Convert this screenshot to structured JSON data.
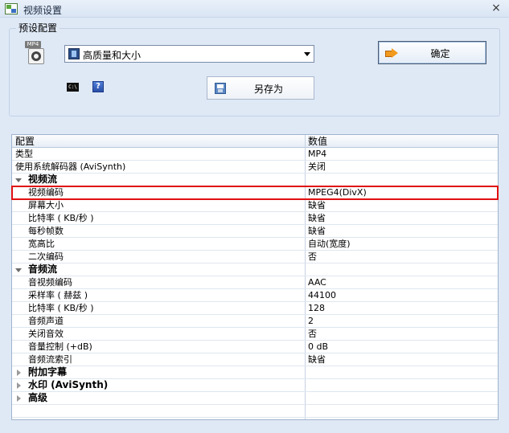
{
  "window": {
    "title": "视频设置",
    "close_glyph": "×"
  },
  "preset": {
    "group_label": "预设配置",
    "icon_tag": "MP4",
    "selected": "高质量和大小",
    "ok_label": "确定",
    "save_as_label": "另存为",
    "cmd_icon_text": "C:\\",
    "help_icon_text": "?"
  },
  "grid": {
    "columns": [
      "配置",
      "数值"
    ],
    "rows": [
      {
        "type": "item",
        "key": "类型",
        "value": "MP4"
      },
      {
        "type": "item",
        "key": "使用系统解码器 (AviSynth)",
        "value": "关闭"
      },
      {
        "type": "category",
        "key": "视频流",
        "expanded": true
      },
      {
        "type": "sub",
        "key": "视频编码",
        "value": "MPEG4(DivX)",
        "selected": true
      },
      {
        "type": "sub",
        "key": "屏幕大小",
        "value": "缺省"
      },
      {
        "type": "sub",
        "key": "比特率 ( KB/秒 )",
        "value": "缺省"
      },
      {
        "type": "sub",
        "key": "每秒帧数",
        "value": "缺省"
      },
      {
        "type": "sub",
        "key": "宽高比",
        "value": "自动(宽度)"
      },
      {
        "type": "sub",
        "key": "二次编码",
        "value": "否"
      },
      {
        "type": "category",
        "key": "音频流",
        "expanded": true
      },
      {
        "type": "sub",
        "key": "音视频编码",
        "value": "AAC"
      },
      {
        "type": "sub",
        "key": "采样率 ( 赫兹 )",
        "value": "44100"
      },
      {
        "type": "sub",
        "key": "比特率 ( KB/秒 )",
        "value": "128"
      },
      {
        "type": "sub",
        "key": "音频声道",
        "value": "2"
      },
      {
        "type": "sub",
        "key": "关闭音效",
        "value": "否"
      },
      {
        "type": "sub",
        "key": "音量控制 (+dB)",
        "value": "0 dB"
      },
      {
        "type": "sub",
        "key": "音频流索引",
        "value": "缺省"
      },
      {
        "type": "category",
        "key": "附加字幕",
        "expanded": false
      },
      {
        "type": "category",
        "key": "水印 (AviSynth)",
        "expanded": false
      },
      {
        "type": "category",
        "key": "高级",
        "expanded": false
      }
    ]
  },
  "colors": {
    "selection_outline": "#e01010",
    "background": "#dfe9f6"
  }
}
